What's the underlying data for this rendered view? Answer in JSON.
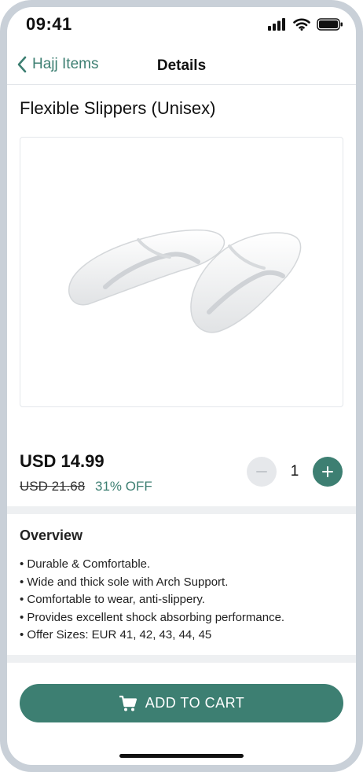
{
  "status_bar": {
    "time": "09:41"
  },
  "nav": {
    "back_label": "Hajj Items",
    "title": "Details"
  },
  "product": {
    "title": "Flexible Slippers (Unisex)",
    "image": "white-slippers-image",
    "price": "USD 14.99",
    "old_price": "USD 21.68",
    "discount": "31% OFF",
    "quantity": "1"
  },
  "overview": {
    "title": "Overview",
    "items": [
      "Durable & Comfortable.",
      "Wide and thick sole with Arch Support.",
      "Comfortable to wear, anti-slippery.",
      "Provides excellent shock absorbing performance.",
      "Offer Sizes: EUR 41, 42, 43, 44, 45"
    ]
  },
  "cart": {
    "label": "ADD TO CART"
  },
  "colors": {
    "accent": "#3d7f72",
    "separator": "#eef0f2"
  }
}
